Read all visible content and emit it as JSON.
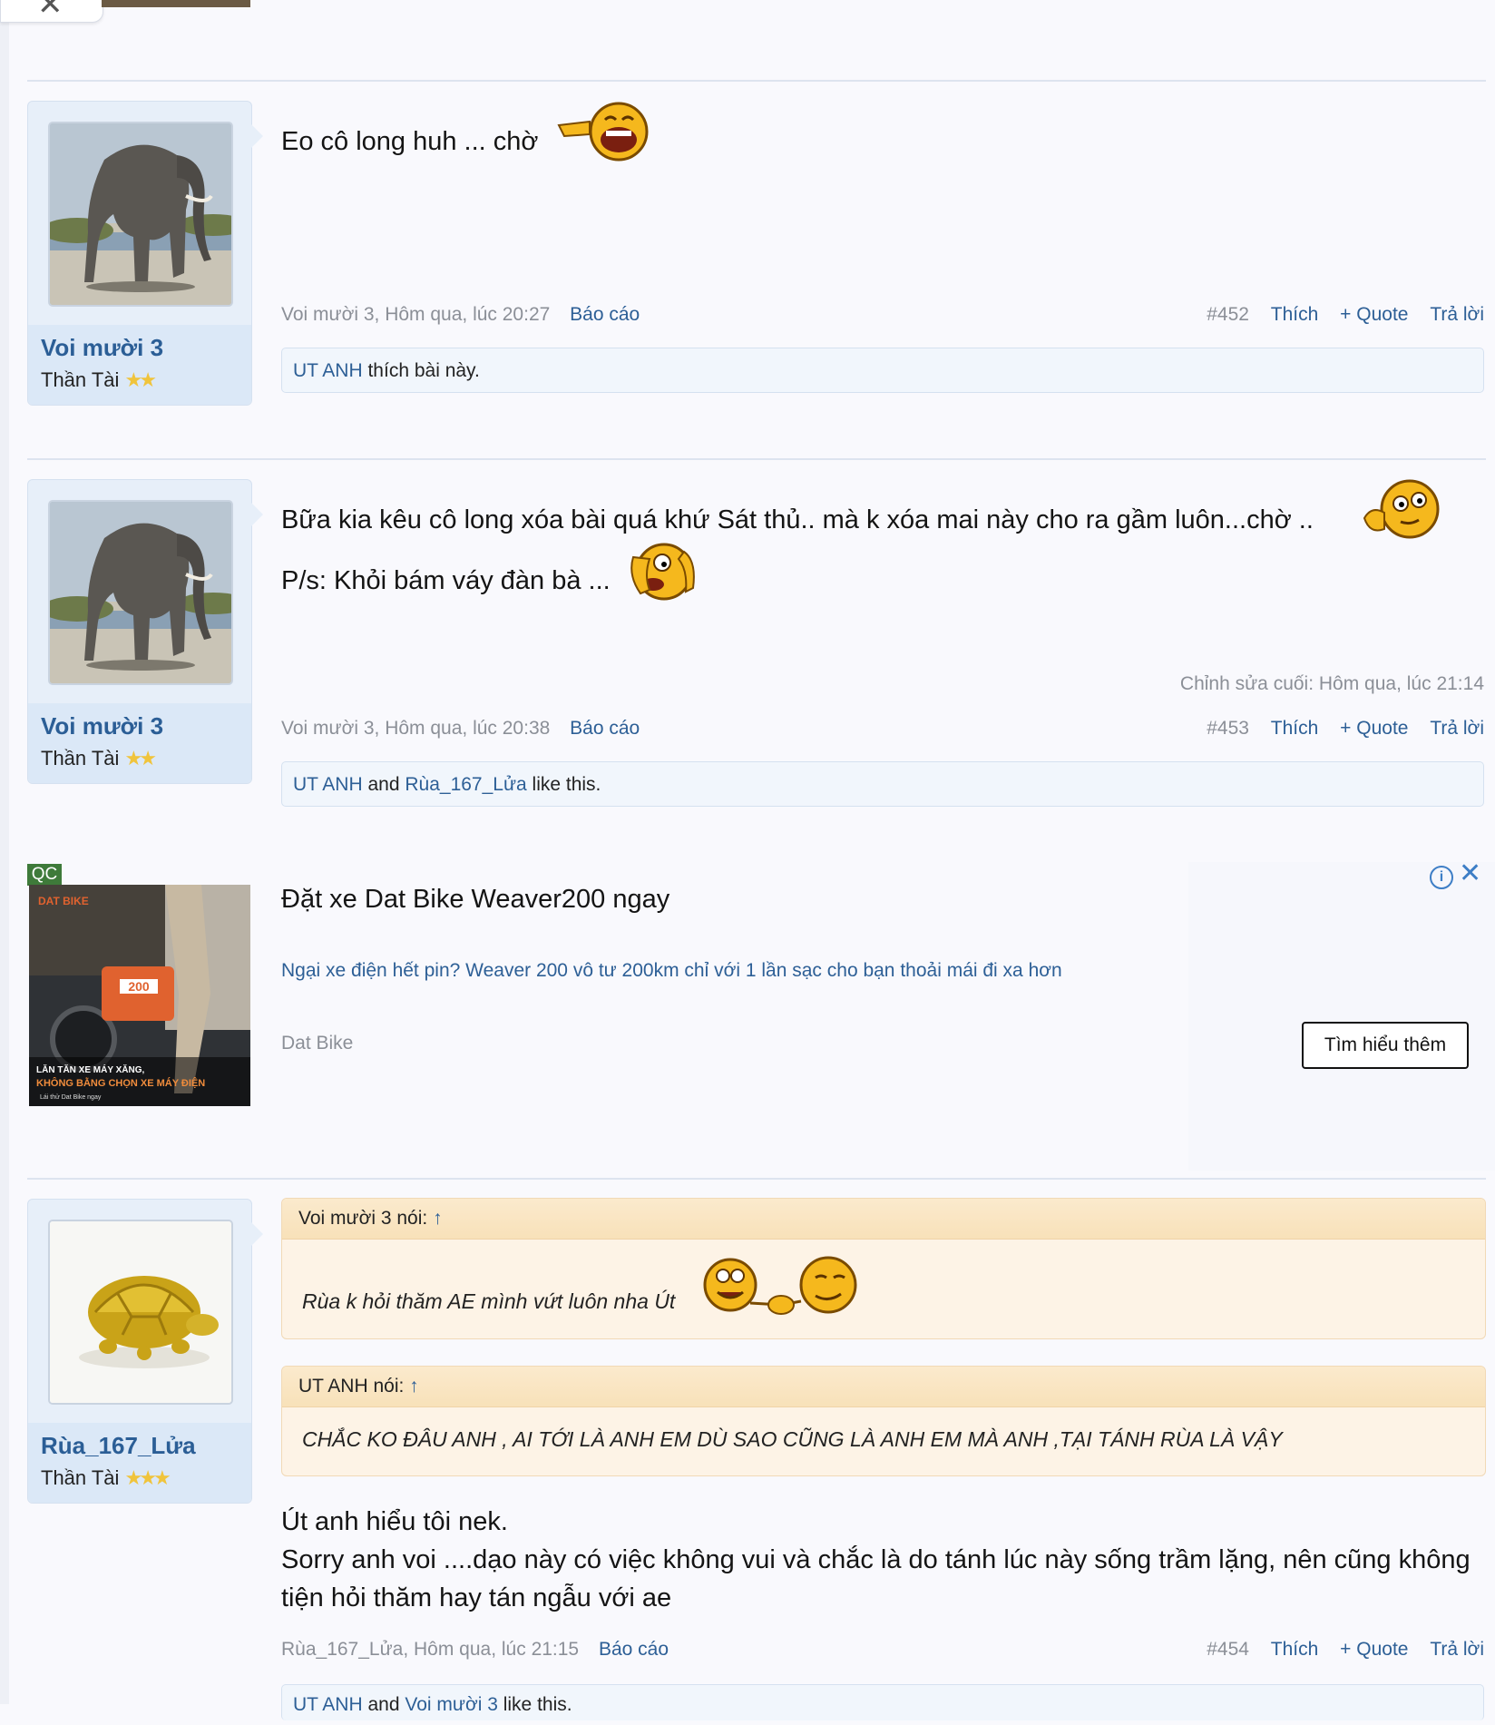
{
  "colors": {
    "link": "#2d5f96",
    "accent_star": "#f0c43c",
    "quote_bg": "#fdf3e6",
    "panel_bg": "#e7eff9"
  },
  "posts": [
    {
      "username": "Voi mười 3",
      "user_title": "Thần Tài",
      "stars": "★★",
      "message": "Eo cô long huh ... chờ",
      "meta_author_time": "Voi mười 3, Hôm qua, lúc 20:27",
      "report": "Báo cáo",
      "number": "#452",
      "like": "Thích",
      "quote": "+ Quote",
      "reply": "Trả lời",
      "likes_user1": "UT ANH",
      "likes_suffix": " thích bài này."
    },
    {
      "username": "Voi mười 3",
      "user_title": "Thần Tài",
      "stars": "★★",
      "message_line1": "Bữa kia kêu cô long xóa bài quá khứ Sát thủ.. mà k xóa mai này cho ra gầm luôn...chờ ..",
      "message_line2": "P/s: Khỏi bám váy đàn bà ...",
      "edited": "Chỉnh sửa cuối: Hôm qua, lúc 21:14",
      "meta_author_time": "Voi mười 3, Hôm qua, lúc 20:38",
      "report": "Báo cáo",
      "number": "#453",
      "like": "Thích",
      "quote": "+ Quote",
      "reply": "Trả lời",
      "likes_user1": "UT ANH",
      "likes_and": " and ",
      "likes_user2": "Rùa_167_Lửa",
      "likes_suffix": " like this."
    },
    {
      "username": "Rùa_167_Lửa",
      "user_title": "Thần Tài",
      "stars": "★★★",
      "quote1_head": "Voi mười 3 nói:",
      "quote1_arrow": "↑",
      "quote1_body": "Rùa k hỏi thăm AE mình vứt luôn nha Út",
      "quote2_head": "UT ANH nói:",
      "quote2_arrow": "↑",
      "quote2_body": "CHẮC KO ĐÂU ANH , AI TỚI LÀ ANH EM DÙ SAO CŨNG LÀ ANH EM MÀ ANH ,TẠI TÁNH RÙA LÀ VẬY",
      "message_line1": "Út anh hiểu tôi nek.",
      "message_line2": "Sorry anh voi ....dạo này có việc không vui và chắc là do tánh lúc này sống trầm lặng, nên cũng không tiện hỏi thăm hay tán ngẫu với ae",
      "meta_author_time": "Rùa_167_Lửa, Hôm qua, lúc 21:15",
      "report": "Báo cáo",
      "number": "#454",
      "like": "Thích",
      "quote": "+ Quote",
      "reply": "Trả lời",
      "likes_user1": "UT ANH",
      "likes_and": " and ",
      "likes_user2": "Voi mười 3",
      "likes_suffix": " like this."
    }
  ],
  "ad": {
    "badge": "QC",
    "title": "Đặt xe Dat Bike Weaver200 ngay",
    "description": "Ngại xe điện hết pin? Weaver 200 vô tư 200km chỉ với 1 lần sạc cho bạn thoải mái đi xa hơn",
    "brand": "Dat Bike",
    "cta": "Tìm hiểu thêm",
    "image_text1": "LĂN TĂN XE MÁY XĂNG,",
    "image_text2": "KHÔNG BẰNG CHỌN XE MÁY ĐIỆN",
    "image_text3": "Lái thử Dat Bike ngay",
    "image_logo": "DAT BIKE",
    "image_plate": "200"
  }
}
